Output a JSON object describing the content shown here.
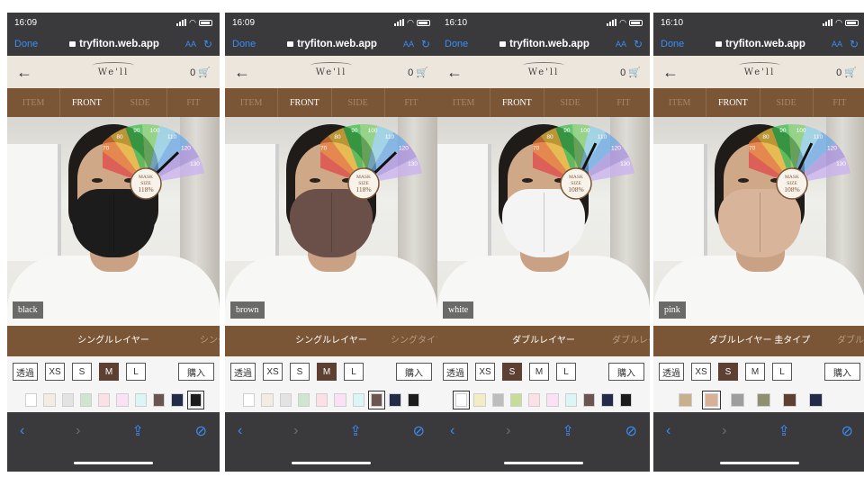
{
  "browser": {
    "done_label": "Done",
    "url": "tryfiton.web.app",
    "aa_label": "AA",
    "reload_glyph": "↻",
    "toolbar": {
      "back": "‹",
      "forward": "›",
      "share": "⇪",
      "compass": "⊘"
    }
  },
  "app": {
    "back_glyph": "←",
    "logo": "We'll",
    "cart_count": "0",
    "cart_glyph": "🛒"
  },
  "tabs": [
    "ITEM",
    "FRONT",
    "SIDE",
    "FIT"
  ],
  "sizes": [
    "透過",
    "XS",
    "S",
    "M",
    "L"
  ],
  "buy_label": "購入",
  "dial": {
    "title": "MASK",
    "subtitle": "SIZE",
    "ticks": [
      "70",
      "80",
      "90",
      "100",
      "110",
      "120",
      "130"
    ]
  },
  "colors": {
    "brand_brown": "#7b5636",
    "selected_size": "#5e4032",
    "safari_blue": "#3b8cf5"
  },
  "phones": [
    {
      "time": "16:09",
      "color_label": "black",
      "mask_color": "#1c1c1c",
      "mask_size": "118%",
      "dial_value": 118,
      "layer_prev": "",
      "layer_main": "シングルレイヤー",
      "layer_next": "シング",
      "selected_size": "M",
      "swatches": [
        "#ffffff",
        "#f2ece2",
        "#e3e3e3",
        "#cfe5cf",
        "#fbe1e6",
        "#fbe1f4",
        "#dcf5f5",
        "#6a5550",
        "#232a4a",
        "#1c1c1c"
      ],
      "selected_swatch": 9
    },
    {
      "time": "16:09",
      "color_label": "brown",
      "mask_color": "#6a5049",
      "mask_size": "118%",
      "dial_value": 118,
      "layer_prev": "",
      "layer_main": "シングルレイヤー",
      "layer_next": "シングタイプ",
      "selected_size": "M",
      "swatches": [
        "#ffffff",
        "#f2ece2",
        "#e3e3e3",
        "#cfe5cf",
        "#fbe1e6",
        "#fbe1f4",
        "#dcf5f5",
        "#6a5550",
        "#232a4a",
        "#1c1c1c"
      ],
      "selected_swatch": 7
    },
    {
      "time": "16:10",
      "color_label": "white",
      "mask_color": "#f4f4f4",
      "mask_size": "108%",
      "dial_value": 108,
      "layer_prev": "",
      "layer_main": "ダブルレイヤー",
      "layer_next": "ダブルレイ",
      "selected_size": "S",
      "swatches": [
        "#ffffff",
        "#f3edc4",
        "#bdbdbd",
        "#c8dc9a",
        "#fbe1e6",
        "#fbe1f4",
        "#dcf5f5",
        "#6a5550",
        "#232a4a",
        "#1c1c1c"
      ],
      "selected_swatch": 0
    },
    {
      "time": "16:10",
      "color_label": "pink",
      "mask_color": "#d8b49a",
      "mask_size": "108%",
      "dial_value": 108,
      "layer_prev": "ヤー",
      "layer_main": "ダブルレイヤー 圭タイプ",
      "layer_next": "ダブルレ",
      "selected_size": "S",
      "swatches": [
        "#c9b08c",
        "#d9b095",
        "#9e9e9e",
        "#8e9070",
        "#5e4032",
        "#232a4a"
      ],
      "selected_swatch": 1
    }
  ]
}
